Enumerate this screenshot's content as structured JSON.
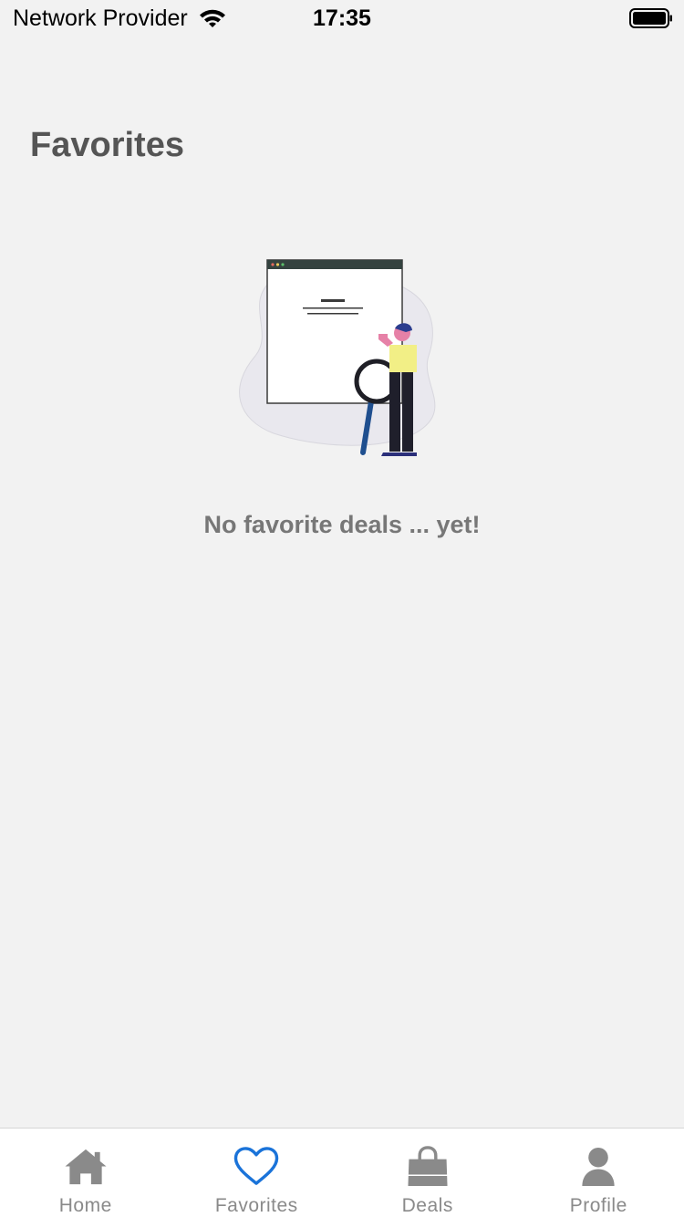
{
  "status_bar": {
    "carrier": "Network Provider",
    "time": "17:35",
    "icons": [
      "wifi-icon",
      "battery-icon"
    ]
  },
  "page": {
    "title": "Favorites",
    "empty_message": "No favorite deals ... yet!"
  },
  "tab_bar": {
    "active_color": "#1a73d9",
    "inactive_color": "#8a8a8a",
    "tabs": [
      {
        "label": "Home",
        "icon": "home-icon",
        "active": false
      },
      {
        "label": "Favorites",
        "icon": "heart-icon",
        "active": true
      },
      {
        "label": "Deals",
        "icon": "shopping-bag-icon",
        "active": false
      },
      {
        "label": "Profile",
        "icon": "user-icon",
        "active": false
      }
    ]
  }
}
